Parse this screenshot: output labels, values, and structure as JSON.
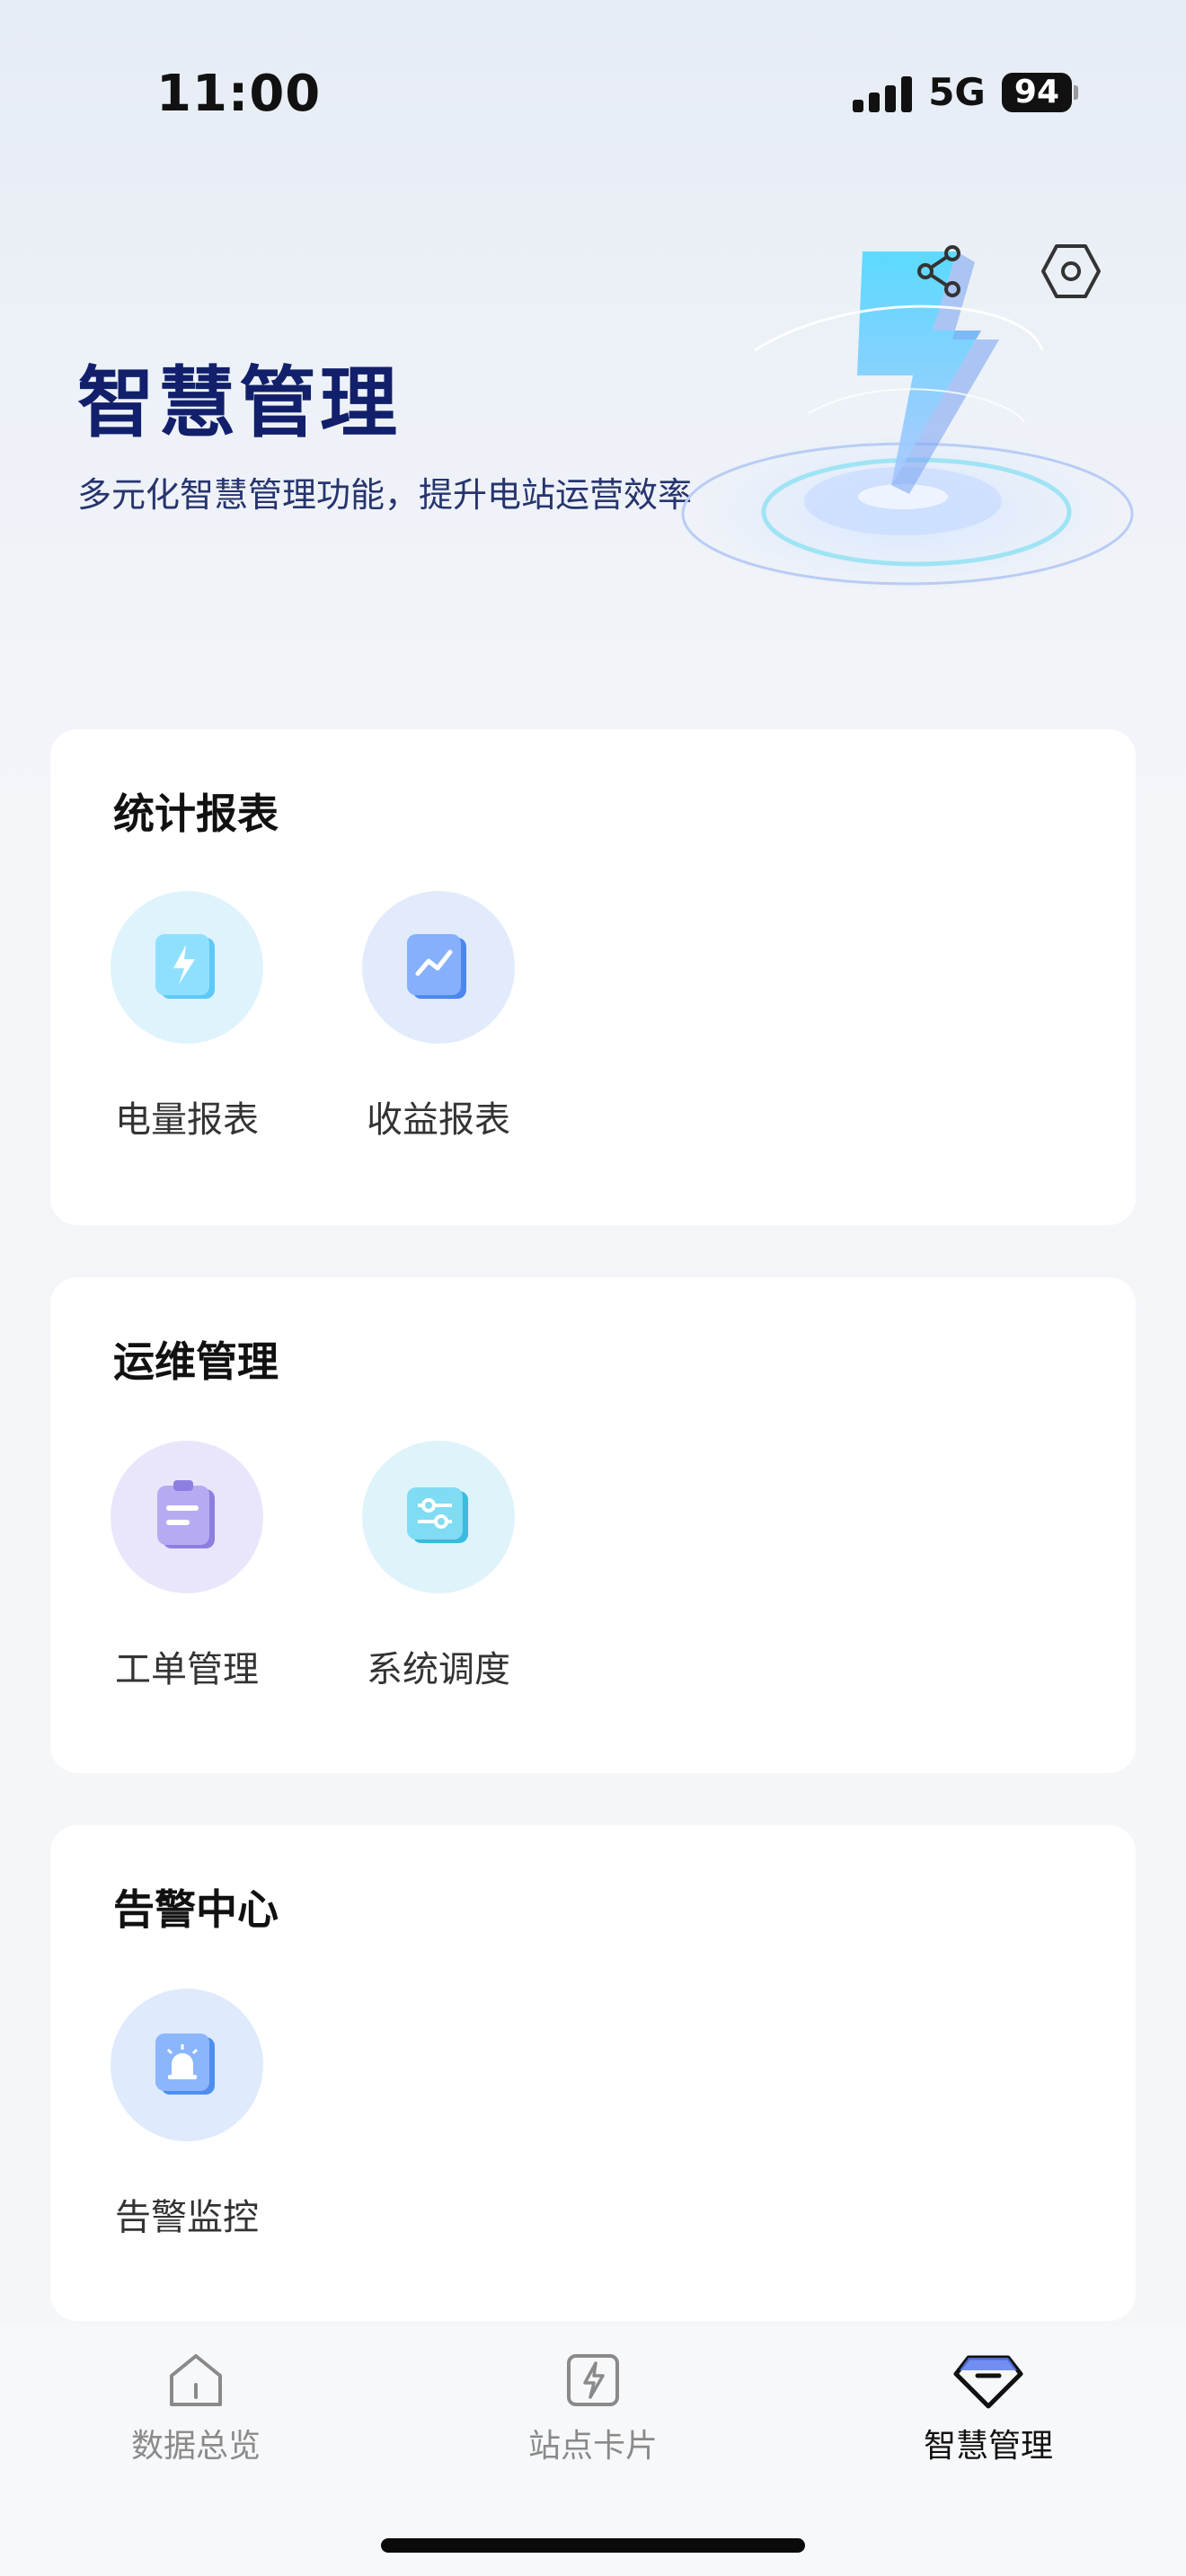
{
  "status_bar": {
    "time": "11:00",
    "network": "5G",
    "battery": "94"
  },
  "header": {
    "title": "智慧管理",
    "subtitle": "多元化智慧管理功能，提升电站运营效率",
    "icons": [
      "share-icon",
      "settings-icon"
    ]
  },
  "sections": [
    {
      "title": "统计报表",
      "items": [
        {
          "label": "电量报表",
          "icon": "power-report-icon"
        },
        {
          "label": "收益报表",
          "icon": "revenue-report-icon"
        }
      ]
    },
    {
      "title": "运维管理",
      "items": [
        {
          "label": "工单管理",
          "icon": "work-order-icon"
        },
        {
          "label": "系统调度",
          "icon": "system-dispatch-icon"
        }
      ]
    },
    {
      "title": "告警中心",
      "items": [
        {
          "label": "告警监控",
          "icon": "alarm-monitor-icon"
        }
      ]
    }
  ],
  "tabbar": {
    "tabs": [
      {
        "label": "数据总览",
        "icon": "home-icon",
        "active": false
      },
      {
        "label": "站点卡片",
        "icon": "bolt-card-icon",
        "active": false
      },
      {
        "label": "智慧管理",
        "icon": "gem-icon",
        "active": true
      }
    ]
  },
  "colors": {
    "title": "#12206b",
    "active_tab": "#111111",
    "inactive_tab": "#8a8a8a"
  }
}
